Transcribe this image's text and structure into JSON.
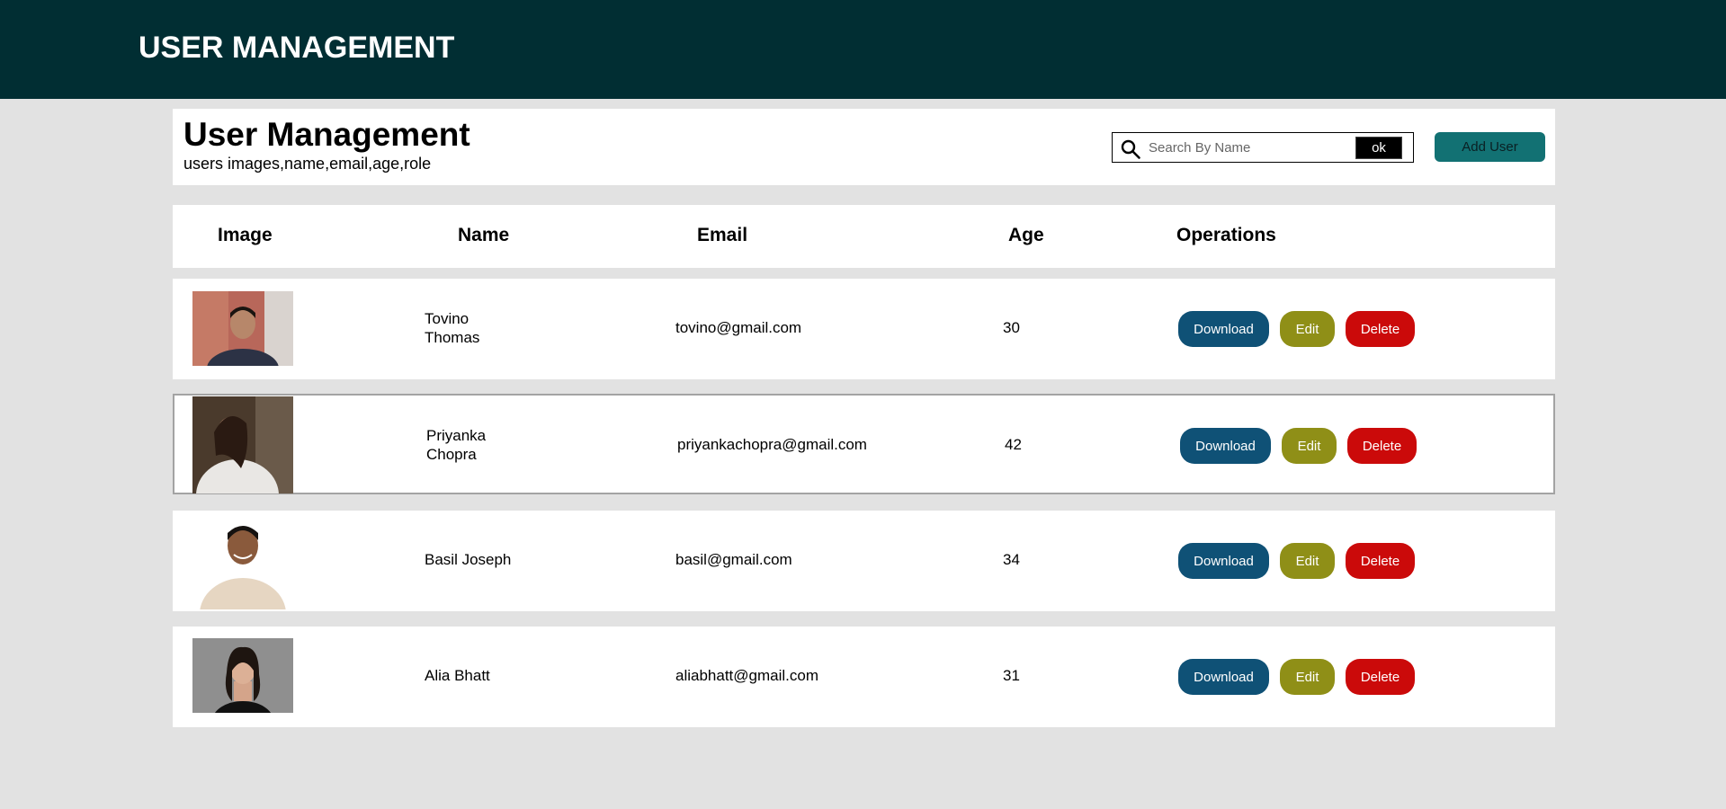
{
  "topbar": {
    "title": "USER MANAGEMENT"
  },
  "header": {
    "title": "User Management",
    "subtitle": "users images,name,email,age,role",
    "search": {
      "placeholder": "Search By Name",
      "value": "",
      "ok_label": "ok"
    },
    "add_user_label": "Add User"
  },
  "table": {
    "columns": [
      "Image",
      "Name",
      "Email",
      "Age",
      "Operations"
    ],
    "rows": [
      {
        "name": "Tovino Thomas",
        "email": "tovino@gmail.com",
        "age": "30",
        "download": "Download",
        "edit": "Edit",
        "delete": "Delete",
        "image_icon": "user-photo"
      },
      {
        "name": "Priyanka Chopra",
        "email": "priyankachopra@gmail.com",
        "age": "42",
        "download": "Download",
        "edit": "Edit",
        "delete": "Delete",
        "image_icon": "user-photo"
      },
      {
        "name": "Basil Joseph",
        "email": "basil@gmail.com",
        "age": "34",
        "download": "Download",
        "edit": "Edit",
        "delete": "Delete",
        "image_icon": "user-photo"
      },
      {
        "name": "Alia Bhatt",
        "email": "aliabhatt@gmail.com",
        "age": "31",
        "download": "Download",
        "edit": "Edit",
        "delete": "Delete",
        "image_icon": "user-photo"
      }
    ]
  },
  "colors": {
    "topbar": "#012e33",
    "add_user": "#127173",
    "download": "#0f5176",
    "edit": "#8f8f17",
    "delete": "#cb0a0a"
  }
}
